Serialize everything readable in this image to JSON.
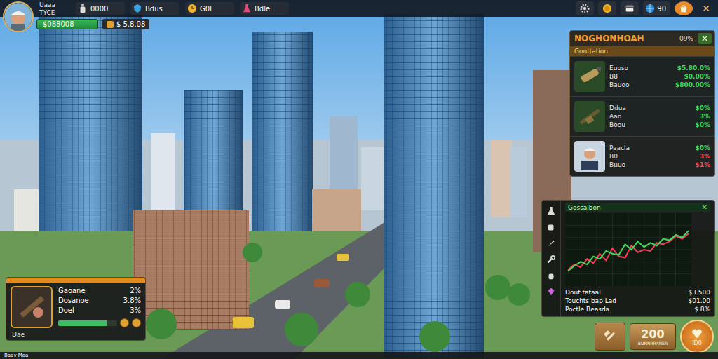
{
  "player": {
    "name": "Uaaa TYCE",
    "cash": "$088008",
    "balance": "$ 5.8.08"
  },
  "resources": [
    {
      "kind": "bottle",
      "value": "0000"
    },
    {
      "kind": "shield",
      "value": "Bdus"
    },
    {
      "kind": "clock",
      "value": "G0I"
    },
    {
      "kind": "flask",
      "value": "Bdle"
    }
  ],
  "top_buttons": [
    {
      "kind": "gear"
    },
    {
      "kind": "coin"
    },
    {
      "kind": "card"
    },
    {
      "kind": "globe",
      "label": "90"
    },
    {
      "kind": "shop"
    },
    {
      "kind": "close",
      "label": "✕"
    }
  ],
  "market": {
    "title": "NOGHONHOAH",
    "badge": "09%",
    "close": "✕",
    "section": "Gonttation",
    "items": [
      {
        "kind": "bottle",
        "labels": [
          "Euoso",
          "B8",
          "Bauoo"
        ],
        "values": [
          {
            "text": "$5.80.0%",
            "color": "#3ddc5a"
          },
          {
            "text": "$0.00%",
            "color": "#3ddc5a"
          },
          {
            "text": "$800.00%",
            "color": "#3ddc5a"
          }
        ]
      },
      {
        "kind": "rifle",
        "labels": [
          "Ddua",
          "Aao",
          "Boou"
        ],
        "values": [
          {
            "text": "$0%",
            "color": "#3ddc5a"
          },
          {
            "text": "3%",
            "color": "#3ddc5a"
          },
          {
            "text": "$0%",
            "color": "#3ddc5a"
          }
        ]
      },
      {
        "kind": "dealer",
        "labels": [
          "Paacla",
          "B0",
          "Buuo"
        ],
        "values": [
          {
            "text": "$0%",
            "color": "#3ddc5a"
          },
          {
            "text": "3%",
            "color": "#ff4d4d"
          },
          {
            "text": "$1%",
            "color": "#ff4d4d"
          }
        ]
      }
    ]
  },
  "chart": {
    "title": "Gossalbon",
    "close": "✕",
    "tools": [
      {
        "kind": "flask"
      },
      {
        "kind": "cup"
      },
      {
        "kind": "knife"
      },
      {
        "kind": "wrench"
      },
      {
        "kind": "hand"
      },
      {
        "kind": "gem"
      }
    ],
    "series": [
      {
        "color": "#ff3b5c",
        "values": [
          20,
          28,
          24,
          36,
          30,
          44,
          34,
          52,
          40,
          38,
          56,
          46,
          50,
          48,
          60,
          58,
          62,
          70,
          66,
          74
        ]
      },
      {
        "color": "#3ddc5a",
        "values": [
          18,
          26,
          32,
          28,
          40,
          36,
          48,
          44,
          42,
          58,
          50,
          62,
          54,
          60,
          56,
          66,
          64,
          72,
          68,
          78
        ]
      }
    ],
    "stats": [
      {
        "label": "Dout tataal",
        "value": "$3.500"
      },
      {
        "label": "Touchts bap Lad",
        "value": "$01.00"
      },
      {
        "label": "Poctle Beasda",
        "value": "$.8%"
      }
    ]
  },
  "card": {
    "rows": [
      {
        "label": "Gaoane",
        "value": "2%"
      },
      {
        "label": "Dosanoe",
        "value": "3.8%"
      },
      {
        "label": "Doel",
        "value": "3%"
      }
    ],
    "level": 0.82,
    "caption": "Dae"
  },
  "actions": {
    "count": "200",
    "count_caption": "BUNNRRANER",
    "main": "ID0"
  },
  "status_bar": "Baav Maa"
}
